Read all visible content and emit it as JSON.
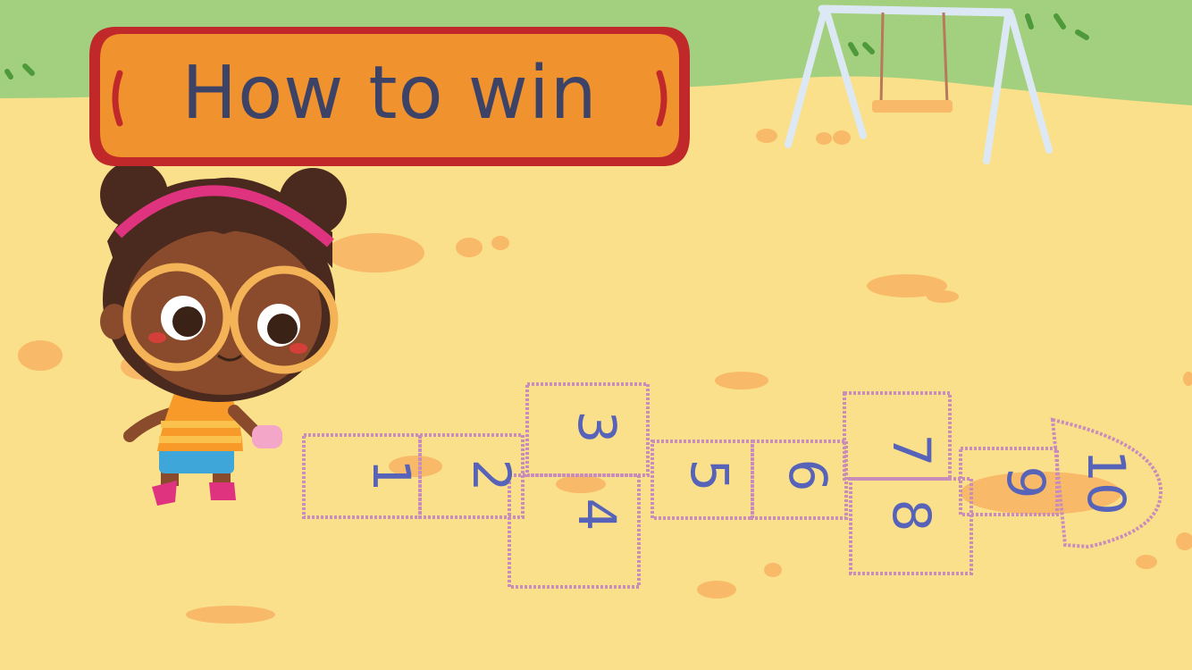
{
  "title": "How to win",
  "hopscotch": {
    "numbers": [
      "1",
      "2",
      "3",
      "4",
      "5",
      "6",
      "7",
      "8",
      "9",
      "10"
    ]
  },
  "colors": {
    "ground": "#fae08a",
    "grass": "#a3d07f",
    "banner_fill": "#f0922e",
    "banner_border": "#c0282a",
    "title_text": "#3c4367",
    "chalk": "#c98dbb",
    "numbers": "#5663b8",
    "swing_frame": "#dce9f5"
  },
  "icons": [
    "girl-character-icon",
    "swing-set-icon",
    "chalk-stone-icon"
  ]
}
